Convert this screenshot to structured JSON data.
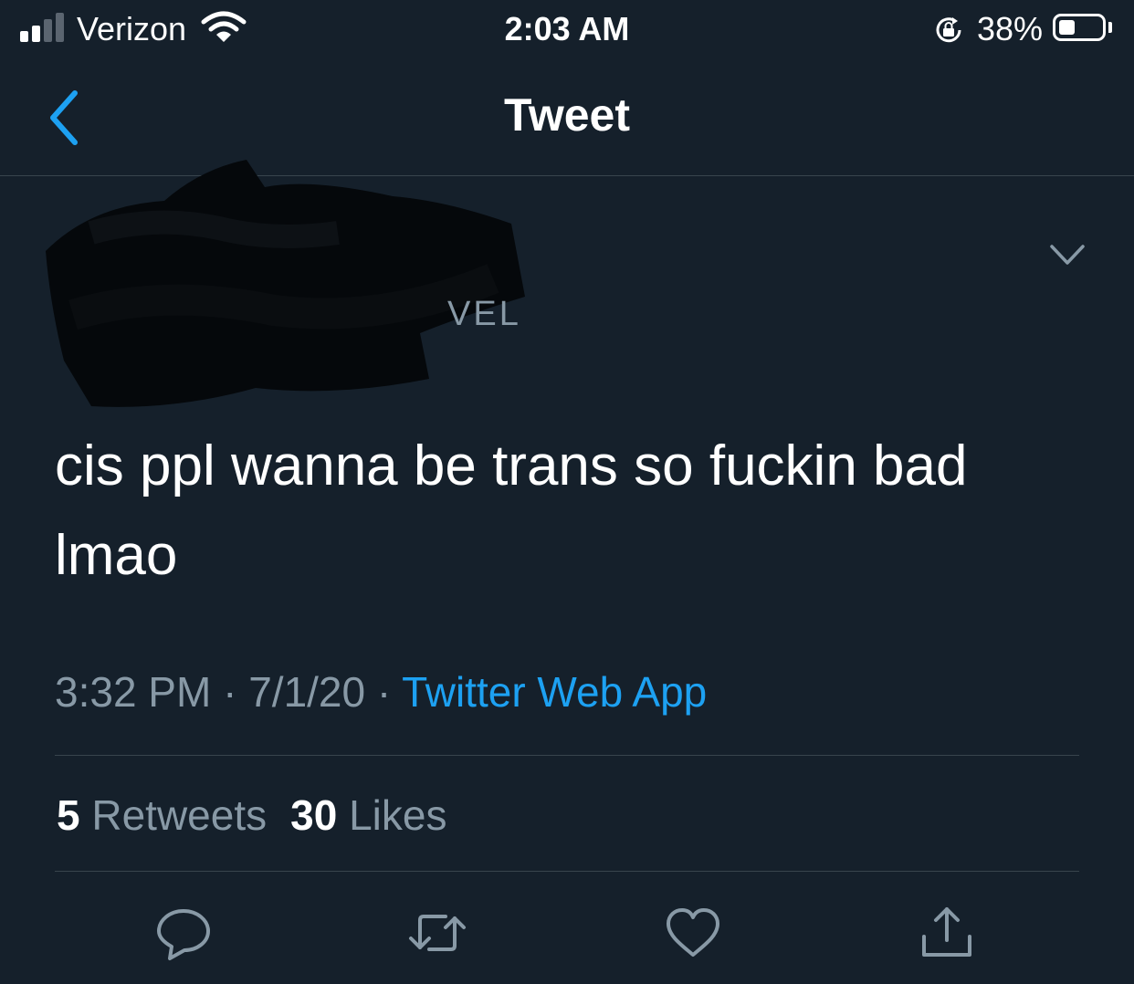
{
  "status_bar": {
    "carrier": "Verizon",
    "time": "2:03 AM",
    "battery_percent": "38%",
    "battery_level": 0.38,
    "signal_bars": 2,
    "signal_bars_total": 4,
    "icons": [
      "cellular-signal-icon",
      "wifi-icon",
      "rotation-lock-icon",
      "battery-icon"
    ]
  },
  "nav": {
    "title": "Tweet",
    "back_icon": "chevron-left-icon"
  },
  "tweet": {
    "handle_partial": "VEL",
    "text": "cis ppl wanna be trans so fuckin bad lmao",
    "time": "3:32 PM",
    "date": "7/1/20",
    "separator": " · ",
    "source": "Twitter Web App",
    "more_icon": "chevron-down-icon"
  },
  "stats": {
    "retweets_count": "5",
    "retweets_label": "Retweets",
    "likes_count": "30",
    "likes_label": "Likes"
  },
  "actions": [
    "reply-icon",
    "retweet-icon",
    "like-icon",
    "share-icon"
  ],
  "colors": {
    "background": "#15202b",
    "accent": "#1da1f2",
    "secondary_text": "#8899a6",
    "divider": "#38444d"
  }
}
